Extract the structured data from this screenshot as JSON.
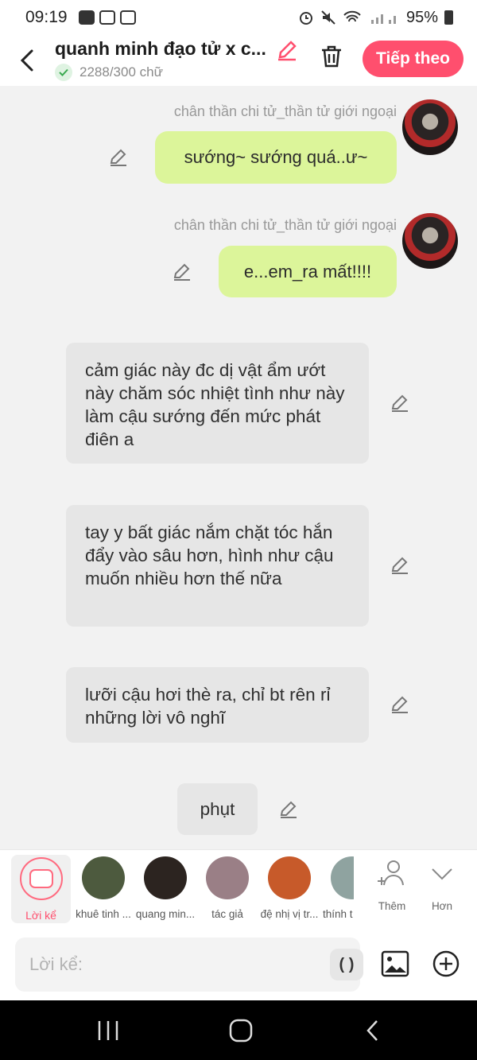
{
  "status_bar": {
    "time": "09:19",
    "battery": "95%"
  },
  "header": {
    "title": "quanh minh đạo tử x c...",
    "word_count": "2288/300 chữ",
    "next_label": "Tiếp theo"
  },
  "messages": [
    {
      "type": "character",
      "sender": "chân thần chi tử_thần tử giới ngoại",
      "text": "sướng~ sướng quá..ư~"
    },
    {
      "type": "character",
      "sender": "chân thần chi tử_thần tử giới ngoại",
      "text": "e...em_ra mất!!!!"
    },
    {
      "type": "narration",
      "text": "cảm giác này đc dị vật ẩm ướt này chăm sóc nhiệt tình như này làm cậu sướng đến mức phát điên a"
    },
    {
      "type": "narration",
      "text": "tay y bất giác nắm chặt tóc hắn đẩy vào sâu hơn, hình như cậu muốn nhiều hơn thế nữa"
    },
    {
      "type": "narration",
      "text": "lưỡi cậu hơi thè ra, chỉ bt rên rỉ những lời vô nghĩ"
    },
    {
      "type": "narration",
      "text": "phụt"
    }
  ],
  "character_bar": {
    "narration_label": "Lời kể",
    "characters": [
      {
        "name": "khuê tinh ...",
        "color": "#4d5a3e"
      },
      {
        "name": "quang min...",
        "color": "#2c2420"
      },
      {
        "name": "tác giả",
        "color": "#9a7f86"
      },
      {
        "name": "đệ nhị vị tr...",
        "color": "#c75a2a"
      },
      {
        "name": "thính t",
        "color": "#8fa3a0"
      }
    ],
    "add_label": "Thêm",
    "more_label": "Hơn"
  },
  "input": {
    "placeholder": "Lời kể:",
    "paren_label": "( )"
  },
  "colors": {
    "accent": "#ff4f6e",
    "user_bubble": "#dcf59a",
    "narration_bubble": "#e6e6e6"
  }
}
